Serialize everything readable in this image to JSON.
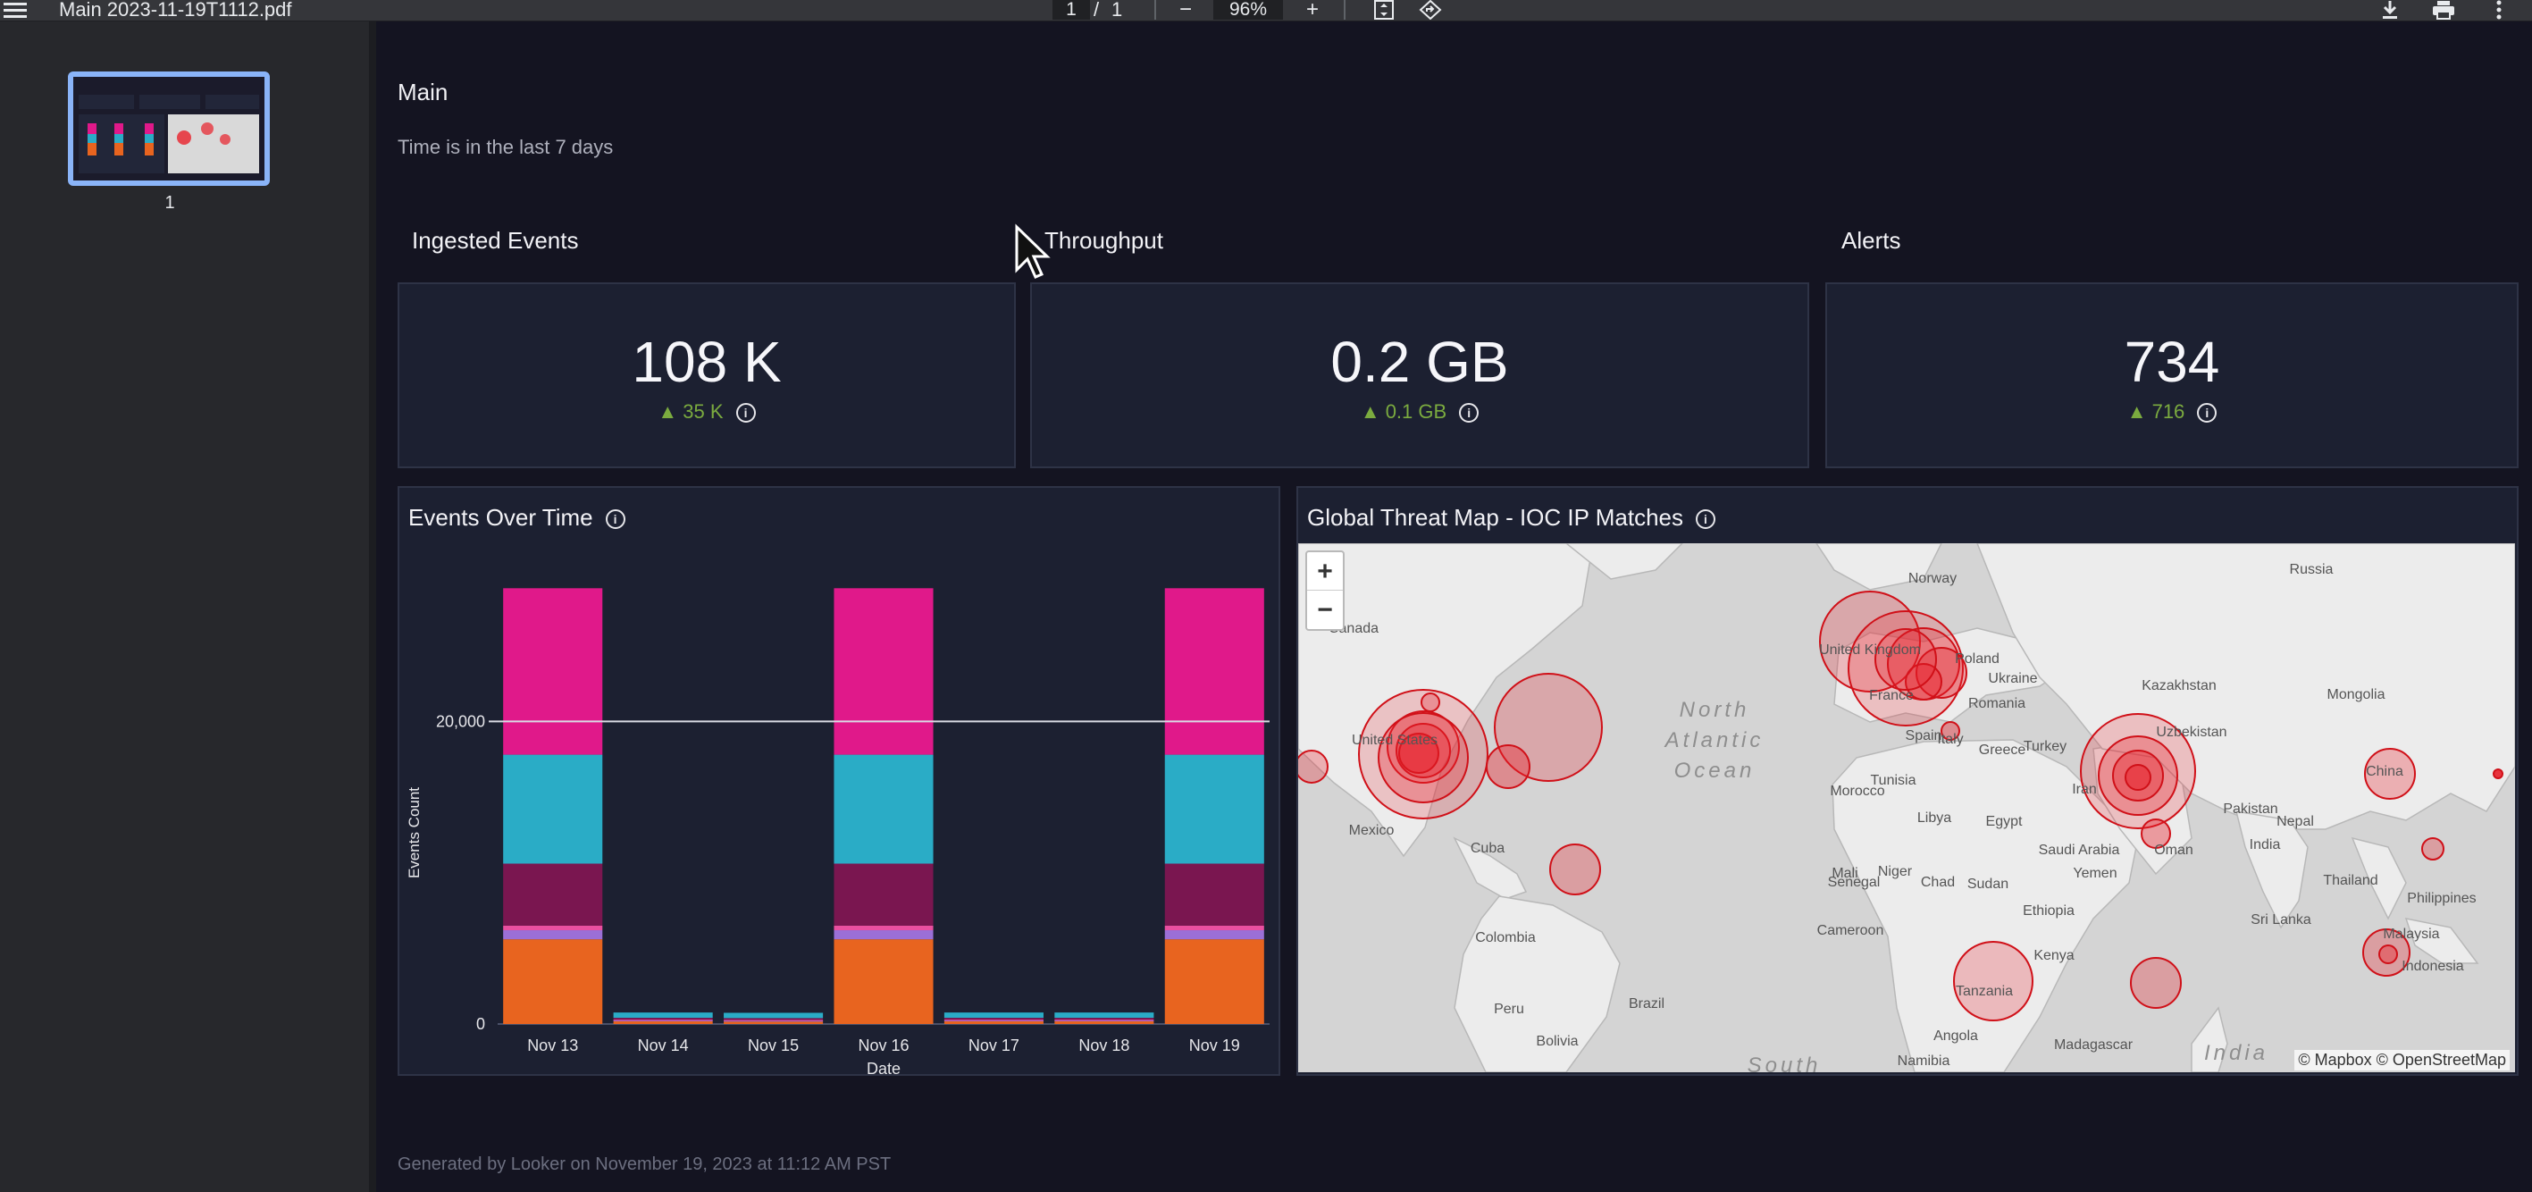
{
  "viewer": {
    "menu_icon": "menu-icon",
    "filename": "Main 2023-11-19T1112.pdf",
    "page_current": "1",
    "page_sep": "/",
    "page_total": "1",
    "zoom_out_label": "−",
    "zoom_value": "96%",
    "zoom_in_label": "+",
    "thumbnail_label": "1"
  },
  "dashboard": {
    "title": "Main",
    "filter_text": "Time is in the last 7 days",
    "tiles": [
      {
        "title": "Ingested Events",
        "value": "108 K",
        "delta": "▲ 35 K"
      },
      {
        "title": "Throughput",
        "value": "0.2 GB",
        "delta": "▲ 0.1 GB"
      },
      {
        "title": "Alerts",
        "value": "734",
        "delta": "▲ 716"
      }
    ],
    "events_panel": {
      "title": "Events Over Time"
    },
    "map_panel": {
      "title": "Global Threat Map - IOC IP Matches",
      "zoom_in": "+",
      "zoom_out": "−",
      "attribution": "© Mapbox © OpenStreetMap",
      "labels": [
        "Canada",
        "United States",
        "Mexico",
        "Cuba",
        "Colombia",
        "Peru",
        "Brazil",
        "Bolivia",
        "Norway",
        "United Kingdom",
        "France",
        "Poland",
        "Ukraine",
        "Romania",
        "Spain",
        "Italy",
        "Greece",
        "Turkey",
        "Morocco",
        "Tunisia",
        "Libya",
        "Egypt",
        "Mali",
        "Niger",
        "Chad",
        "Sudan",
        "Senegal",
        "Cameroon",
        "Ethiopia",
        "Kenya",
        "Tanzania",
        "Angola",
        "Namibia",
        "Madagascar",
        "Yemen",
        "Oman",
        "Saudi Arabia",
        "Iran",
        "Uzbekistan",
        "Kazakhstan",
        "Russia",
        "Mongolia",
        "China",
        "Pakistan",
        "Nepal",
        "India",
        "Thailand",
        "Philippines",
        "Sri Lanka",
        "Malaysia",
        "Indonesia",
        "North Atlantic Ocean",
        "India",
        "South"
      ]
    },
    "footer": "Generated by Looker on November 19, 2023 at 11:12 AM PST"
  },
  "chart_data": {
    "type": "bar",
    "stacked": true,
    "categories": [
      "Nov 13",
      "Nov 14",
      "Nov 15",
      "Nov 16",
      "Nov 17",
      "Nov 18",
      "Nov 19"
    ],
    "xlabel": "Date",
    "ylabel": "Events Count",
    "yticks": [
      "0",
      "20,000"
    ],
    "ytick_values": [
      0,
      20000
    ],
    "ylim": [
      0,
      30000
    ],
    "grid": false,
    "series": [
      {
        "color": "#e8641f",
        "values": [
          5600,
          180,
          160,
          5600,
          180,
          180,
          5600
        ]
      },
      {
        "color": "#9b6fd6",
        "values": [
          600,
          60,
          60,
          600,
          60,
          60,
          600
        ]
      },
      {
        "color": "#ea4fa0",
        "values": [
          300,
          50,
          50,
          300,
          50,
          50,
          300
        ]
      },
      {
        "color": "#7a1650",
        "values": [
          4100,
          120,
          120,
          4100,
          120,
          120,
          4100
        ]
      },
      {
        "color": "#2aacc6",
        "values": [
          7200,
          350,
          350,
          7200,
          350,
          350,
          7200
        ]
      },
      {
        "color": "#e0198a",
        "values": [
          11000,
          0,
          0,
          11000,
          0,
          0,
          11000
        ]
      }
    ]
  }
}
